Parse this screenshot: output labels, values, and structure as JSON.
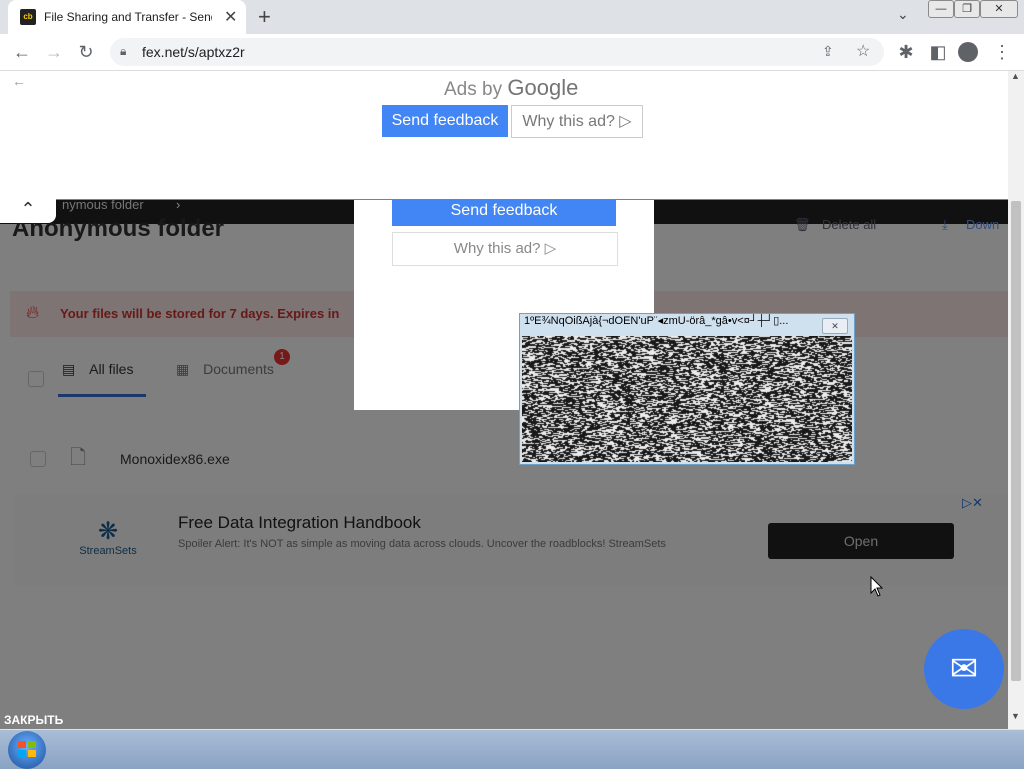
{
  "browser": {
    "tab_title": "File Sharing and Transfer - Send",
    "tab_favicon": "fex",
    "url": "fex.net/s/aptxz2r",
    "new_tab_label": "+",
    "close_tab_label": "✕"
  },
  "top_ad": {
    "ads_by": "Ads by",
    "google": "Google",
    "send_feedback": "Send feedback",
    "why_this_ad": "Why this ad? ▷"
  },
  "mid_ad": {
    "send_feedback": "Send feedback",
    "why_this_ad": "Why this ad? ▷"
  },
  "fex_page": {
    "breadcrumb": "nymous folder",
    "folder_title": "Anonymous folder",
    "delete_all": "Delete all",
    "download": "Down",
    "banner_text": "Your files will be stored for 7 days. Expires in",
    "tabs": [
      {
        "label": "All files"
      },
      {
        "label": "Documents",
        "badge": "1"
      }
    ],
    "files": [
      {
        "name": "Monoxidex86.exe"
      }
    ],
    "close_label": "ЗАКРЫТЬ"
  },
  "promo": {
    "logo_text": "StreamSets",
    "title": "Free Data Integration Handbook",
    "description": "Spoiler Alert: It's NOT as simple as moving data across clouds. Uncover the roadblocks! StreamSets",
    "open_label": "Open",
    "adchoices": "▷✕"
  },
  "noise_window": {
    "title": "1ºE¾NqOißAjà{¬dOEN'uP¨◂zmU-örâ_*gâ•v<¤┘┼┘▯..."
  },
  "colors": {
    "accent": "#4285f4",
    "fab": "#3b78e7",
    "banner_bg": "#fde8e6",
    "banner_text": "#cc3333"
  }
}
